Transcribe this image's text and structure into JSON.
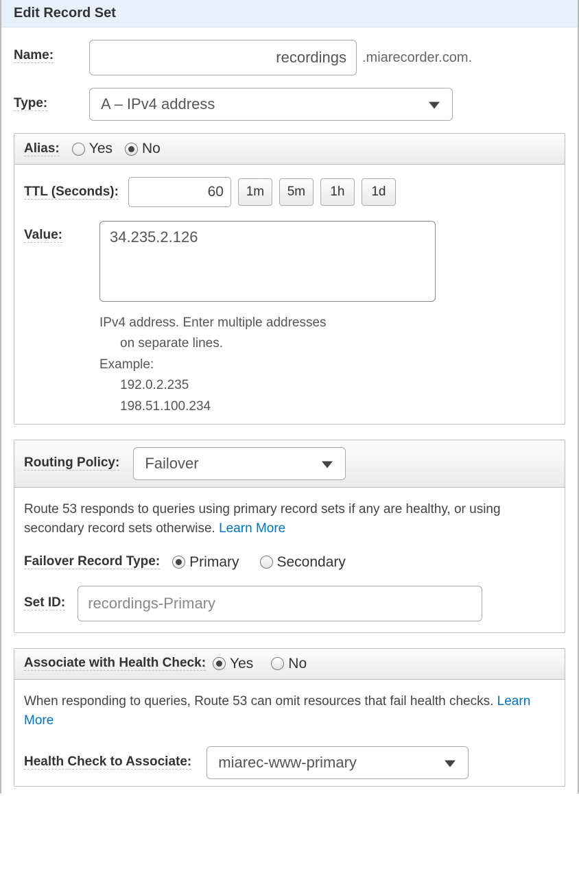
{
  "panel": {
    "title": "Edit Record Set"
  },
  "name": {
    "label": "Name:",
    "value": "recordings",
    "suffix": ".miarecorder.com."
  },
  "type": {
    "label": "Type:",
    "selected": "A – IPv4 address"
  },
  "alias": {
    "label": "Alias:",
    "yes": "Yes",
    "no": "No"
  },
  "ttl": {
    "label": "TTL (Seconds):",
    "value": "60",
    "btn1m": "1m",
    "btn5m": "5m",
    "btn1h": "1h",
    "btn1d": "1d"
  },
  "value": {
    "label": "Value:",
    "content": "34.235.2.126",
    "help1": "IPv4 address. Enter multiple addresses",
    "help2": "on separate lines.",
    "help3": "Example:",
    "help4": "192.0.2.235",
    "help5": "198.51.100.234"
  },
  "routing": {
    "label": "Routing Policy:",
    "selected": "Failover",
    "desc1": "Route 53 responds to queries using primary record sets if any are healthy, or using secondary record sets otherwise.  ",
    "learn": "Learn More",
    "failoverTypeLabel": "Failover Record Type:",
    "primary": "Primary",
    "secondary": "Secondary",
    "setIdLabel": "Set ID:",
    "setIdValue": "recordings-Primary"
  },
  "health": {
    "label": "Associate with Health Check:",
    "yes": "Yes",
    "no": "No",
    "desc": "When responding to queries, Route 53 can omit resources that fail health checks.  ",
    "learn": "Learn More",
    "assocLabel": "Health Check to Associate:",
    "assocSelected": "miarec-www-primary"
  }
}
